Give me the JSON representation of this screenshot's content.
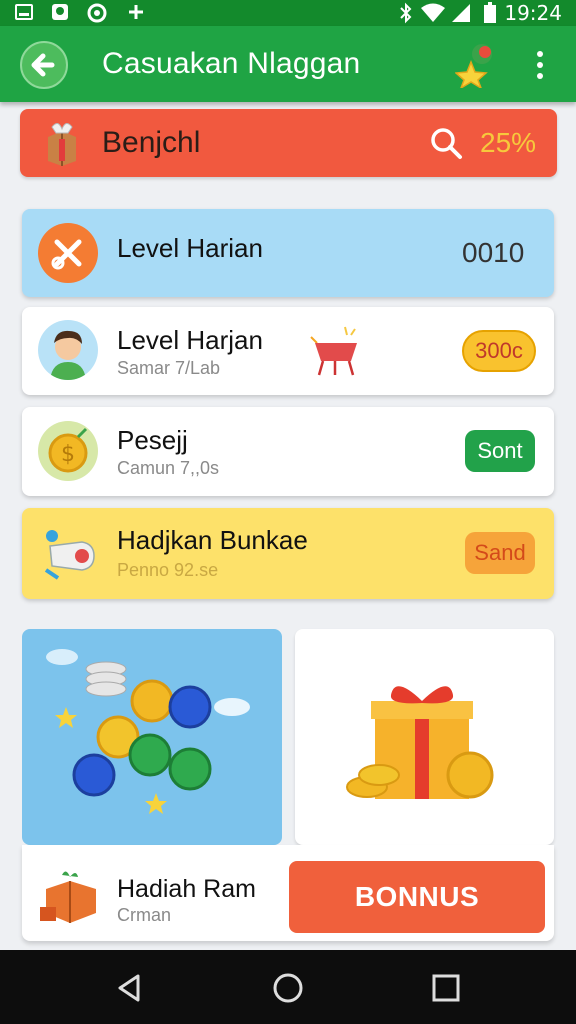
{
  "status_bar": {
    "time": "19:24",
    "icons": [
      "gallery-icon",
      "image-icon",
      "sync-icon",
      "add-icon",
      "bluetooth-icon",
      "wifi-icon",
      "signal-icon",
      "battery-icon"
    ]
  },
  "app_bar": {
    "title": "Casuakan Nlaggan",
    "back_icon": "back-arrow-icon",
    "mascot_icon": "star-mascot-icon",
    "menu_icon": "more-vert-icon"
  },
  "banner": {
    "title": "Benjchl",
    "percent": "25%",
    "icon": "gift-box-icon",
    "search_icon": "search-icon"
  },
  "list": [
    {
      "title": "Level Harian",
      "subtitle": "",
      "value": "0010",
      "icon": "crossed-tools-icon"
    },
    {
      "title": "Level Harjan",
      "subtitle": "Samar 7/Lab",
      "value": "300c",
      "icon": "avatar-icon",
      "extra_icon": "basket-icon"
    },
    {
      "title": "Pesejj",
      "subtitle": "Camun 7,,0s",
      "value": "Sont",
      "icon": "coin-icon"
    },
    {
      "title": "Hadjkan Bunkae",
      "subtitle": "Penno 92.se",
      "value": "Sand",
      "icon": "key-icon"
    }
  ],
  "footer": {
    "title": "Hadiah Ram",
    "subtitle": "Crman",
    "button": "BONNUS",
    "icon": "gift-crate-icon"
  },
  "colors": {
    "appbar": "#1fa444",
    "status": "#138a2c",
    "banner": "#f1593f",
    "card_blue": "#a8dbf6",
    "card_yellow": "#fde16a",
    "bonus": "#f0603c"
  }
}
